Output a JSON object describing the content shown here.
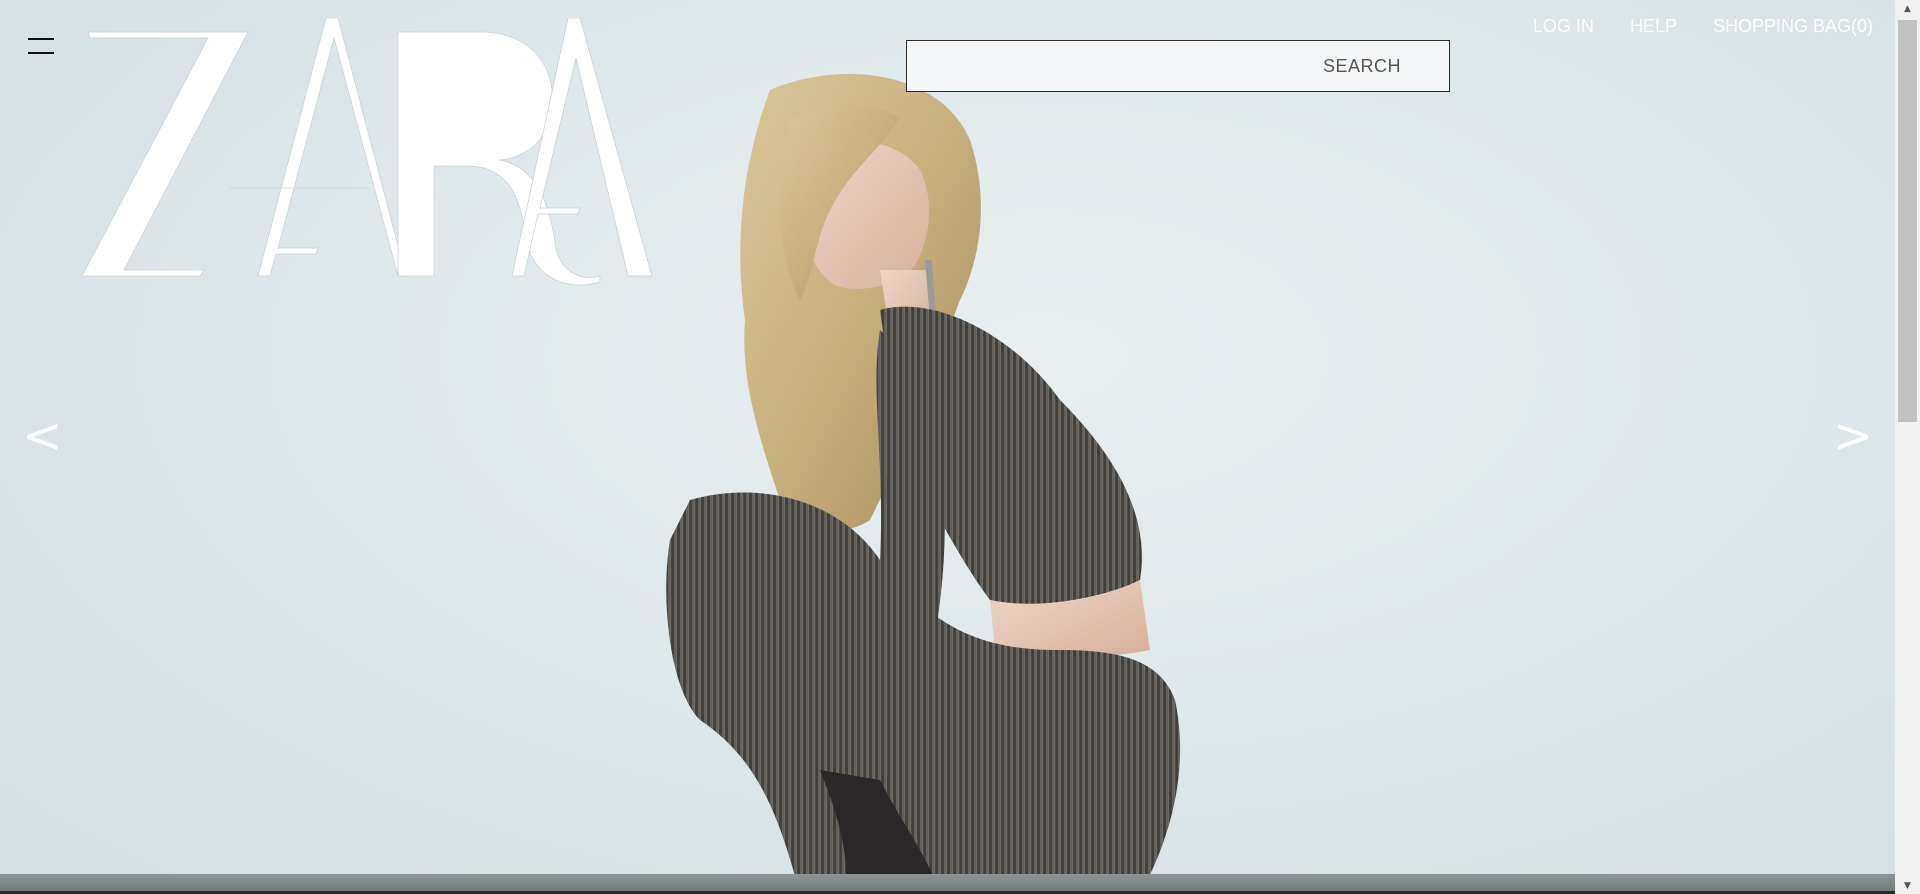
{
  "brand": {
    "logo_text": "ZARA"
  },
  "header": {
    "menu_icon": "hamburger-menu-icon",
    "search": {
      "label": "SEARCH"
    },
    "links": [
      {
        "label": "LOG IN"
      },
      {
        "label": "HELP"
      },
      {
        "label": "SHOPPING BAG(0)"
      }
    ]
  },
  "carousel": {
    "prev_label": "<",
    "next_label": ">"
  },
  "scrollbar": {
    "up_icon": "▲",
    "down_icon": "▼"
  },
  "colors": {
    "background": "#dfe8eb",
    "text_light": "#ffffff",
    "text_dark": "#111111"
  }
}
